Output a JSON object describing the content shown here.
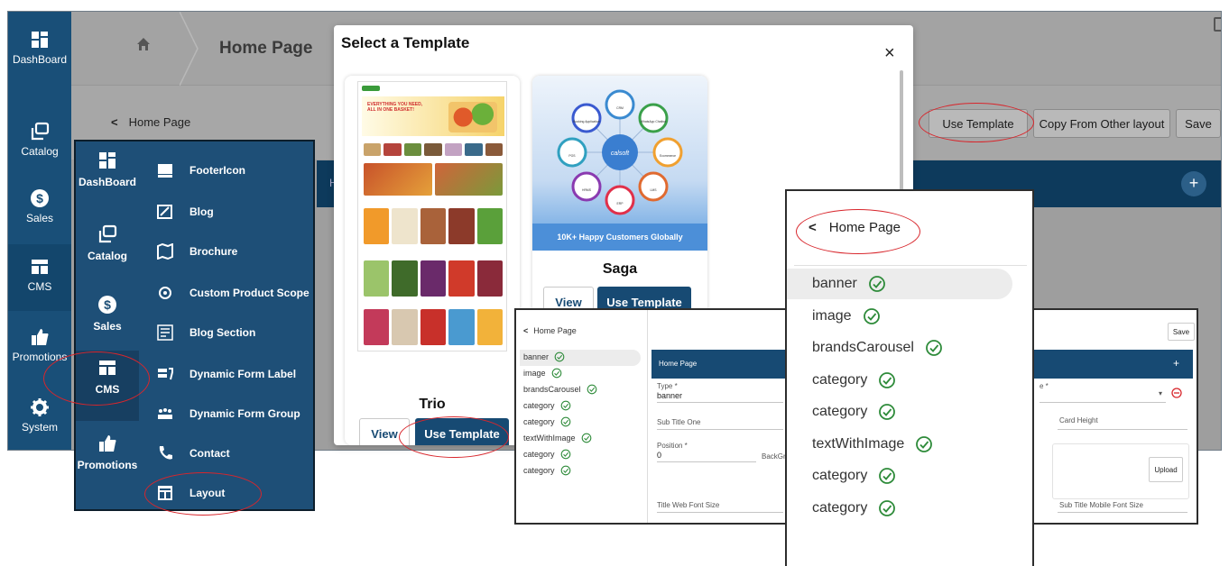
{
  "app": {
    "rail": [
      {
        "label": "DashBoard",
        "icon": "dashboard-icon"
      },
      {
        "label": "Catalog",
        "icon": "catalog-icon"
      },
      {
        "label": "Sales",
        "icon": "dollar-icon"
      },
      {
        "label": "CMS",
        "icon": "cms-icon"
      },
      {
        "label": "Promotions",
        "icon": "thumbs-up-icon"
      },
      {
        "label": "System",
        "icon": "gear-icon"
      }
    ],
    "breadcrumb_title": "Home Page",
    "subheader_back": "Home Page",
    "toolbar": {
      "use_template": "Use Template",
      "copy_layout": "Copy From Other layout",
      "save": "Save"
    },
    "band_letter": "H",
    "plus": "+"
  },
  "cms_menu": {
    "rail": [
      {
        "label": "DashBoard",
        "icon": "dashboard-icon"
      },
      {
        "label": "Catalog",
        "icon": "catalog-icon"
      },
      {
        "label": "Sales",
        "icon": "dollar-icon"
      },
      {
        "label": "CMS",
        "icon": "cms-icon"
      },
      {
        "label": "Promotions",
        "icon": "thumbs-up-icon"
      }
    ],
    "items": [
      {
        "label": "FooterIcon",
        "icon": "footer-icon"
      },
      {
        "label": "Blog",
        "icon": "blog-icon"
      },
      {
        "label": "Brochure",
        "icon": "brochure-icon"
      },
      {
        "label": "Custom Product Scope",
        "icon": "scope-icon"
      },
      {
        "label": "Blog Section",
        "icon": "blog-section-icon"
      },
      {
        "label": "Dynamic Form Label",
        "icon": "form-label-icon"
      },
      {
        "label": "Dynamic Form Group",
        "icon": "form-group-icon"
      },
      {
        "label": "Contact",
        "icon": "phone-icon"
      },
      {
        "label": "Layout",
        "icon": "layout-icon"
      }
    ]
  },
  "modal": {
    "title": "Select a Template",
    "close": "×",
    "templates": [
      {
        "name": "Trio",
        "view": "View",
        "use": "Use Template",
        "banner_text": "EVERYTHING YOU NEED, ALL IN ONE BASKET!"
      },
      {
        "name": "Saga",
        "view": "View",
        "use": "Use Template",
        "banner_text": "10K+ Happy Customers Globally",
        "hub_label": "calsoft",
        "nodes": [
          "Booking Application",
          "CRM",
          "WhatsApp Chatbot",
          "Ecommerce",
          "LMS",
          "ERP",
          "HRMS",
          "POS"
        ]
      }
    ]
  },
  "editor": {
    "back": "Home Page",
    "save": "Save",
    "tree": [
      "banner",
      "image",
      "brandsCarousel",
      "category",
      "category",
      "textWithImage",
      "category",
      "category"
    ],
    "section_title": "Home Page",
    "type_label": "Type *",
    "type_value": "banner",
    "subtitle_one": "Sub Title One",
    "position_label": "Position *",
    "position_value": "0",
    "background_label": "BackGr",
    "title_web_font": "Title Web Font Size",
    "card_height": "Card Height",
    "upload": "Upload",
    "subtitle_mobile_font": "Sub Title Mobile Font Size",
    "type2_label": "e *",
    "plus": "+"
  },
  "tree_zoom": {
    "back": "Home Page",
    "nodes": [
      "banner",
      "image",
      "brandsCarousel",
      "category",
      "category",
      "textWithImage",
      "category",
      "category"
    ]
  },
  "colors": {
    "navy": "#174a73",
    "rail": "#1e4f77",
    "check_green": "#2e8b3a",
    "annotation_red": "#d8262c"
  }
}
